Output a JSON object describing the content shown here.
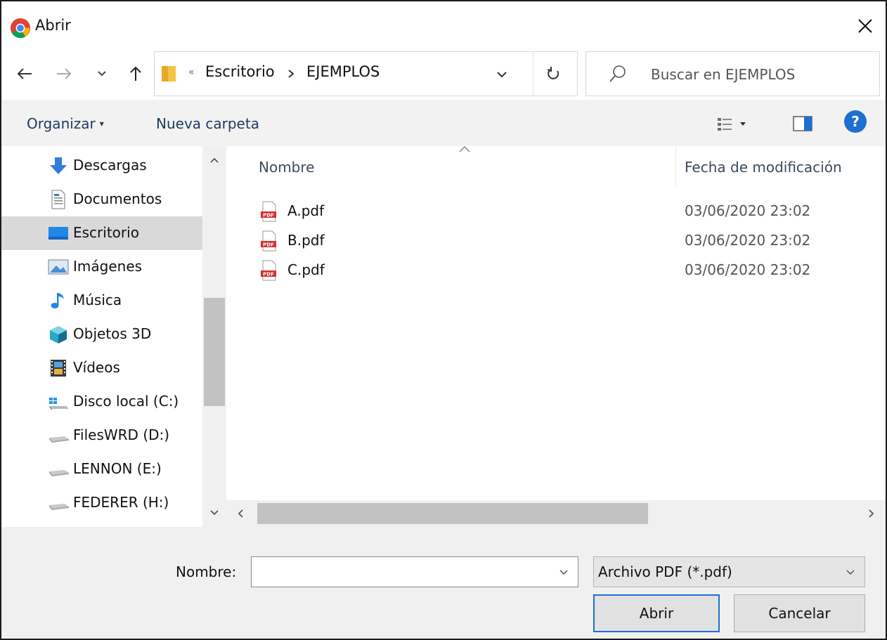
{
  "window": {
    "title": "Abrir",
    "close_glyph": "✕"
  },
  "nav": {
    "back_glyph": "←",
    "forward_glyph": "→",
    "recent_glyph": "⌄",
    "up_glyph": "↑"
  },
  "address": {
    "overflow_glyph": "«",
    "segments": [
      "Escritorio",
      "EJEMPLOS"
    ],
    "separator": "›",
    "dropdown_glyph": "⌄",
    "refresh_glyph": "↻"
  },
  "search": {
    "placeholder": "Buscar en EJEMPLOS"
  },
  "toolbar": {
    "organize_label": "Organizar",
    "new_folder_label": "Nueva carpeta",
    "help_label": "?",
    "caret": "▾"
  },
  "sidebar": {
    "items": [
      {
        "label": "Descargas",
        "icon": "download-icon"
      },
      {
        "label": "Documentos",
        "icon": "document-icon"
      },
      {
        "label": "Escritorio",
        "icon": "desktop-icon",
        "selected": true
      },
      {
        "label": "Imágenes",
        "icon": "image-icon"
      },
      {
        "label": "Música",
        "icon": "music-icon"
      },
      {
        "label": "Objetos 3D",
        "icon": "cube-icon"
      },
      {
        "label": "Vídeos",
        "icon": "video-icon"
      },
      {
        "label": "Disco local (C:)",
        "icon": "windows-drive-icon"
      },
      {
        "label": "FilesWRD (D:)",
        "icon": "drive-icon"
      },
      {
        "label": "LENNON (E:)",
        "icon": "drive-icon"
      },
      {
        "label": "FEDERER (H:)",
        "icon": "drive-icon"
      }
    ]
  },
  "filelist": {
    "columns": {
      "name": "Nombre",
      "modified": "Fecha de modificación"
    },
    "files": [
      {
        "name": "A.pdf",
        "modified": "03/06/2020 23:02"
      },
      {
        "name": "B.pdf",
        "modified": "03/06/2020 23:02"
      },
      {
        "name": "C.pdf",
        "modified": "03/06/2020 23:02"
      }
    ]
  },
  "footer": {
    "filename_label": "Nombre:",
    "filename_value": "",
    "filter_value": "Archivo PDF (*.pdf)",
    "open_label": "Abrir",
    "cancel_label": "Cancelar"
  },
  "colors": {
    "accent": "#1f6fd1",
    "selection": "#d9d9d9",
    "toolbar_bg": "#f2f2f2",
    "pdf_red": "#d32f2f"
  }
}
